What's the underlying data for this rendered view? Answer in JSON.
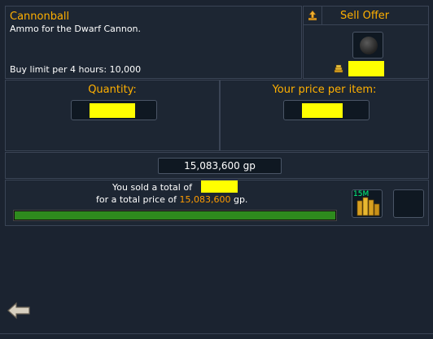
{
  "item": {
    "name": "Cannonball",
    "examine": "Ammo for the Dwarf Cannon.",
    "buy_limit": "Buy limit per 4 hours: 10,000"
  },
  "offer": {
    "type_label": "Sell Offer"
  },
  "quantity": {
    "label": "Quantity:"
  },
  "price": {
    "label": "Your price per item:"
  },
  "total": {
    "value": "15,083,600 gp"
  },
  "status": {
    "line1_prefix": "You sold a total of",
    "line2_prefix": "for a total price of",
    "line2_amount": "15,083,600",
    "line2_suffix": "gp.",
    "progress_fraction": 1.0,
    "coins_stack": "15M"
  },
  "colors": {
    "accent": "#ff9c00",
    "progress": "#2e8a1d",
    "highlight": "#ffff00"
  }
}
